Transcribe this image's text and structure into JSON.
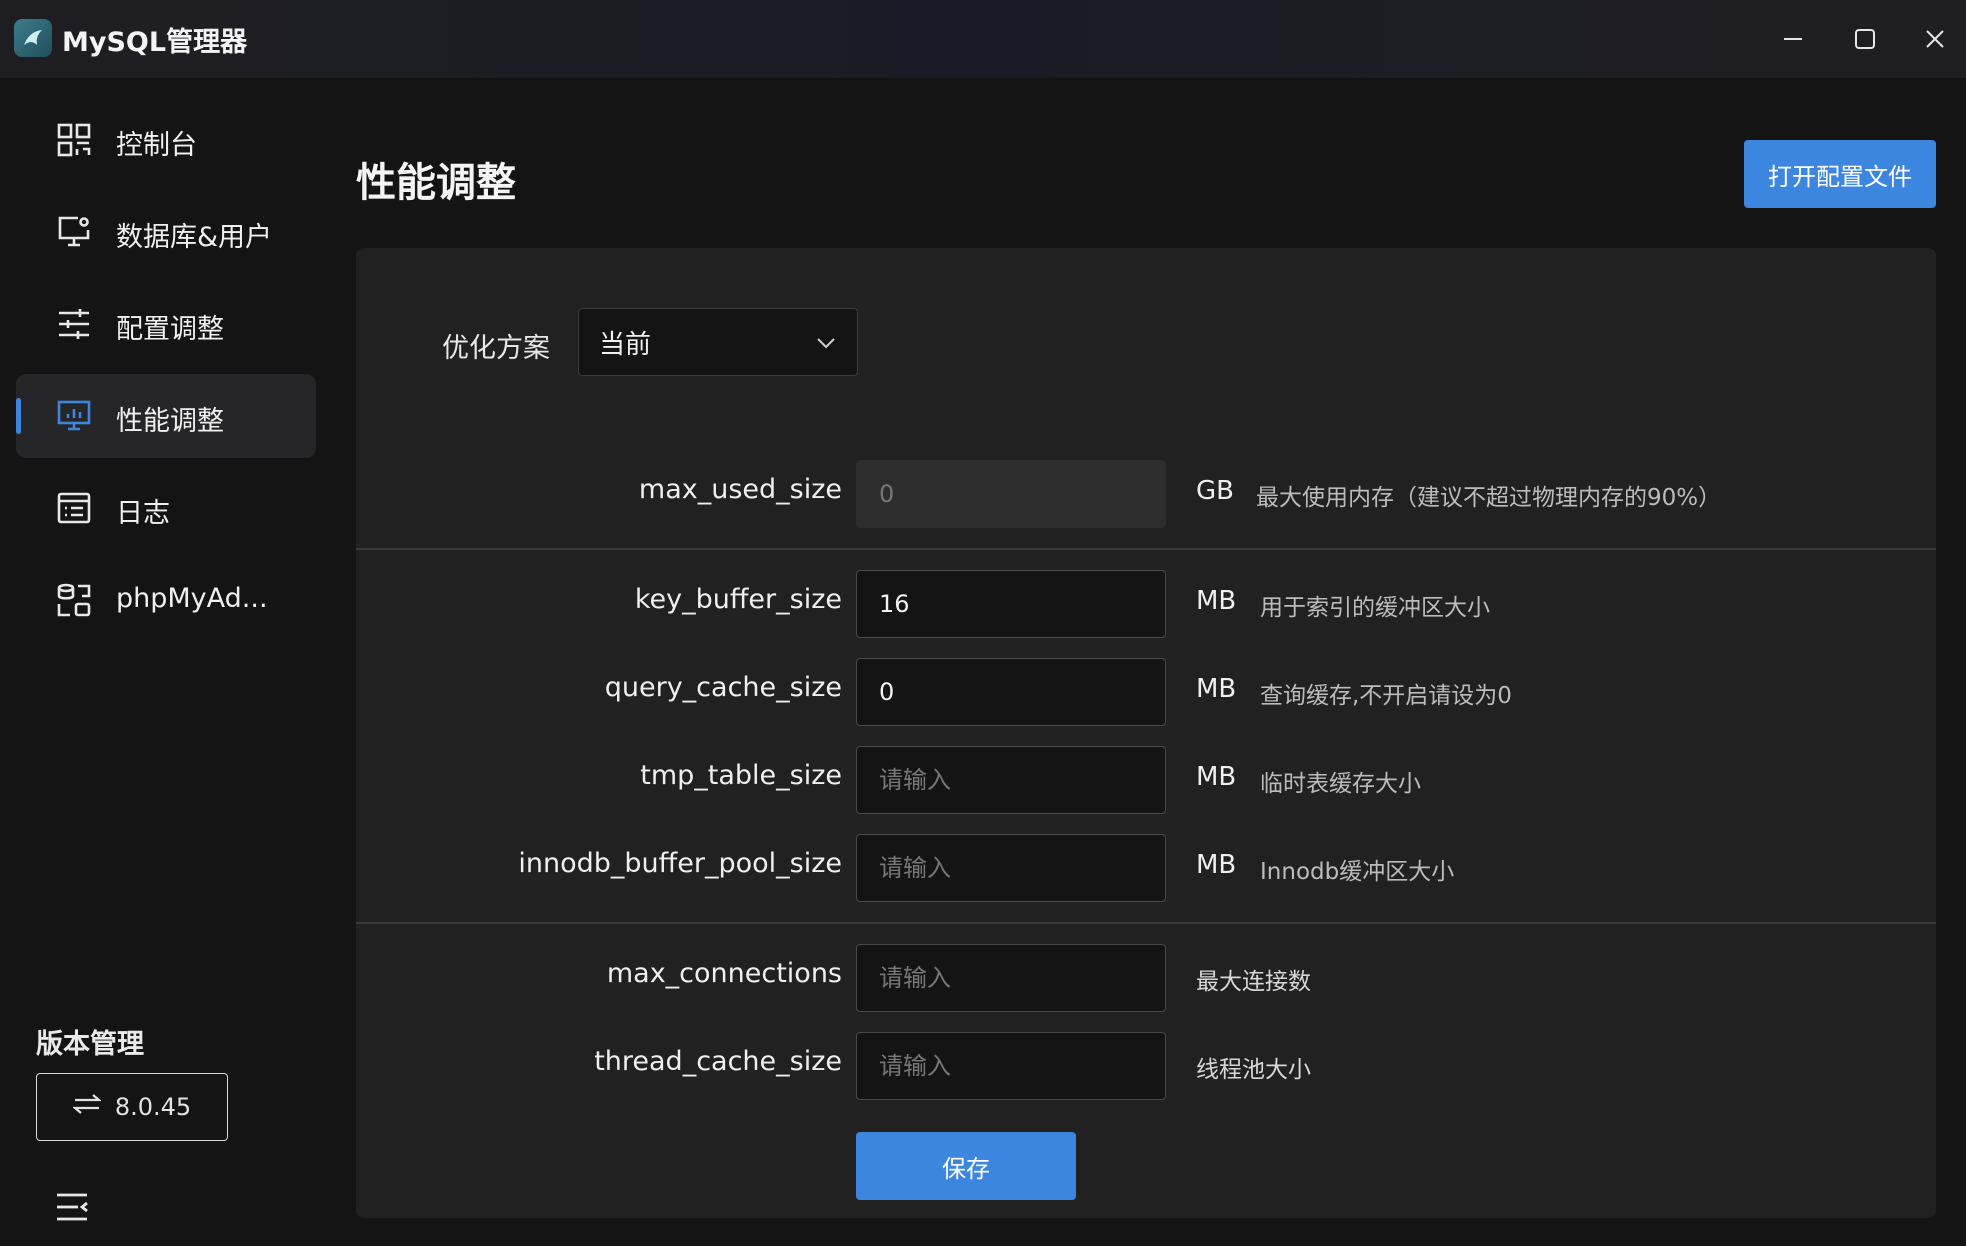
{
  "app": {
    "title": "MySQL管理器",
    "logo_icon": "mysql-dolphin-icon"
  },
  "window_controls": {
    "minimize_icon": "minimize-icon",
    "maximize_icon": "maximize-icon",
    "close_icon": "close-icon"
  },
  "sidebar": {
    "items": [
      {
        "label": "控制台",
        "icon": "dashboard-grid-icon",
        "active": false
      },
      {
        "label": "数据库&用户",
        "icon": "monitor-settings-icon",
        "active": false
      },
      {
        "label": "配置调整",
        "icon": "sliders-icon",
        "active": false
      },
      {
        "label": "性能调整",
        "icon": "monitor-chart-icon",
        "active": true
      },
      {
        "label": "日志",
        "icon": "log-list-icon",
        "active": false
      },
      {
        "label": "phpMyAd...",
        "icon": "database-link-icon",
        "active": false
      }
    ],
    "version_title": "版本管理",
    "version_value": "8.0.45",
    "version_icon": "swap-arrows-icon",
    "menu_icon": "menu-collapse-icon"
  },
  "main": {
    "title": "性能调整",
    "open_config_label": "打开配置文件",
    "scheme": {
      "label": "优化方案",
      "value": "当前"
    },
    "settings": [
      {
        "name": "max_used_size",
        "value": "",
        "placeholder": "0",
        "disabled": true,
        "unit": "GB",
        "desc": "最大使用内存（建议不超过物理内存的90%）"
      },
      {
        "name": "key_buffer_size",
        "value": "16",
        "placeholder": "",
        "disabled": false,
        "unit": "MB",
        "desc": "用于索引的缓冲区大小"
      },
      {
        "name": "query_cache_size",
        "value": "0",
        "placeholder": "",
        "disabled": false,
        "unit": "MB",
        "desc": "查询缓存,不开启请设为0"
      },
      {
        "name": "tmp_table_size",
        "value": "",
        "placeholder": "请输入",
        "disabled": false,
        "unit": "MB",
        "desc": "临时表缓存大小"
      },
      {
        "name": "innodb_buffer_pool_size",
        "value": "",
        "placeholder": "请输入",
        "disabled": false,
        "unit": "MB",
        "desc": "Innodb缓冲区大小"
      },
      {
        "name": "max_connections",
        "value": "",
        "placeholder": "请输入",
        "disabled": false,
        "unit": "",
        "desc": "最大连接数"
      },
      {
        "name": "thread_cache_size",
        "value": "",
        "placeholder": "请输入",
        "disabled": false,
        "unit": "",
        "desc": "线程池大小"
      }
    ],
    "save_label": "保存"
  },
  "colors": {
    "accent": "#3d86e0",
    "background": "#141414",
    "panel": "#212121"
  }
}
